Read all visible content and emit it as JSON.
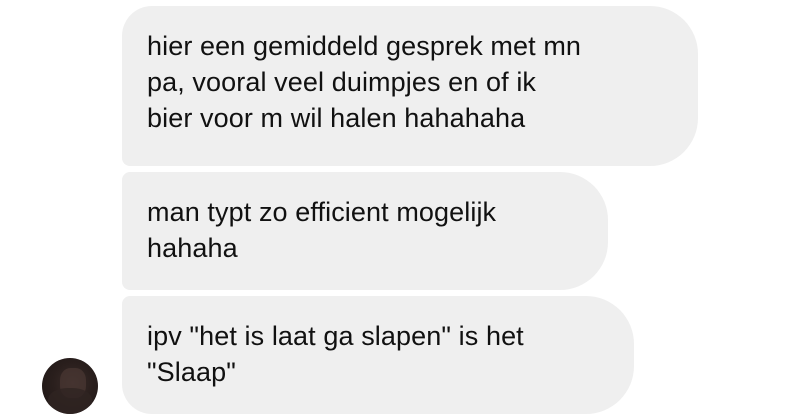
{
  "messages": [
    {
      "text": "hier een gemiddeld gesprek met mn\npa, vooral veel duimpjes en of ik\nbier voor m wil halen hahahaha"
    },
    {
      "text": "man typt zo efficient mogelijk\nhahaha"
    },
    {
      "text": "ipv \"het is laat ga slapen\" is het\n\"Slaap\""
    }
  ],
  "colors": {
    "bubble_background": "#efefef",
    "text": "#111111",
    "background": "#ffffff"
  }
}
